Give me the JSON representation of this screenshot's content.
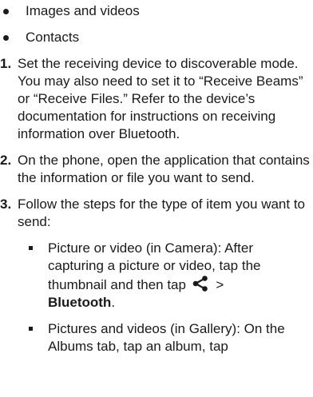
{
  "bullets": [
    {
      "text": "Images and videos"
    },
    {
      "text": "Contacts"
    }
  ],
  "steps": [
    {
      "num": "1.",
      "text": "Set the receiving device to discoverable mode. You may also need to set it to “Receive Beams” or “Receive Files.” Refer to the device’s documentation for instructions on receiving information over Bluetooth."
    },
    {
      "num": "2.",
      "text": "On the phone, open the application that contains the information or file you want to send."
    },
    {
      "num": "3.",
      "text": "Follow the steps for the type of item you want to send:"
    }
  ],
  "sub_items": [
    {
      "pre": "Picture or video (in Camera): After capturing a picture or video, tap the thumbnail and then tap",
      "icon": "share-icon",
      "gt": " >",
      "bold": "Bluetooth",
      "post": "."
    },
    {
      "text": "Pictures and videos (in Gallery): On the Albums tab, tap an album, tap"
    }
  ]
}
